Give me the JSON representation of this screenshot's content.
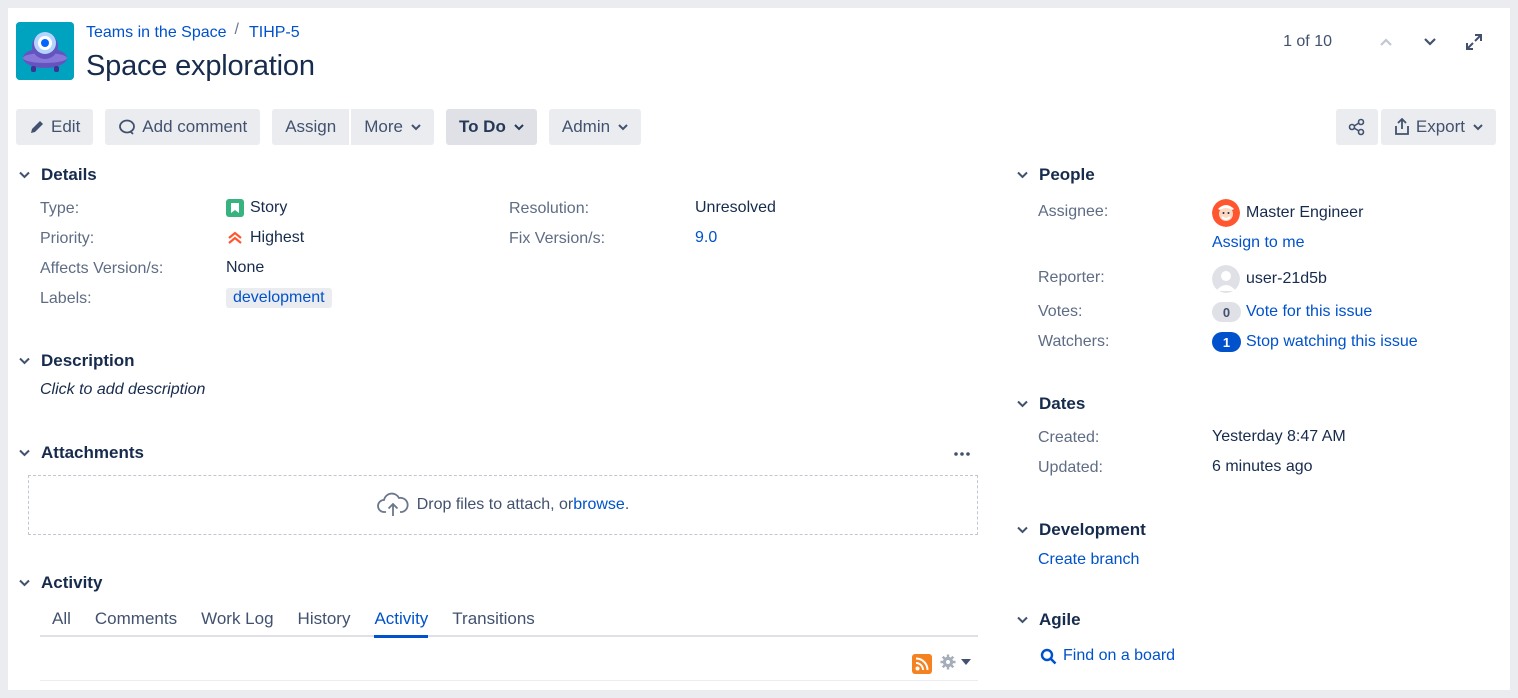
{
  "header": {
    "project_name": "Teams in the Space",
    "breadcrumb_sep": "/",
    "issue_key": "TIHP-5",
    "title": "Space exploration",
    "pager_count": "1 of 10"
  },
  "toolbar": {
    "edit": "Edit",
    "add_comment": "Add comment",
    "assign": "Assign",
    "more": "More",
    "status": "To Do",
    "admin": "Admin",
    "export": "Export"
  },
  "details": {
    "heading": "Details",
    "type_label": "Type:",
    "type_value": "Story",
    "priority_label": "Priority:",
    "priority_value": "Highest",
    "affects_label": "Affects Version/s:",
    "affects_value": "None",
    "labels_label": "Labels:",
    "labels_value": "development",
    "resolution_label": "Resolution:",
    "resolution_value": "Unresolved",
    "fix_label": "Fix Version/s:",
    "fix_value": "9.0"
  },
  "description": {
    "heading": "Description",
    "placeholder": "Click to add description"
  },
  "attachments": {
    "heading": "Attachments",
    "drop_text": "Drop files to attach, or ",
    "browse": "browse",
    "period": "."
  },
  "activity": {
    "heading": "Activity",
    "tabs": [
      "All",
      "Comments",
      "Work Log",
      "History",
      "Activity",
      "Transitions"
    ],
    "active_tab": "Activity"
  },
  "people": {
    "heading": "People",
    "assignee_label": "Assignee:",
    "assignee_value": "Master Engineer",
    "assign_to_me": "Assign to me",
    "reporter_label": "Reporter:",
    "reporter_value": "user-21d5b",
    "votes_label": "Votes:",
    "votes_count": "0",
    "vote_link": "Vote for this issue",
    "watchers_label": "Watchers:",
    "watchers_count": "1",
    "watch_link": "Stop watching this issue"
  },
  "dates": {
    "heading": "Dates",
    "created_label": "Created:",
    "created_value": "Yesterday 8:47 AM",
    "updated_label": "Updated:",
    "updated_value": "6 minutes ago"
  },
  "development": {
    "heading": "Development",
    "create_branch": "Create branch"
  },
  "agile": {
    "heading": "Agile",
    "find_board": "Find on a board"
  },
  "colors": {
    "link": "#0052cc",
    "text": "#172b4d",
    "muted": "#5e6c84",
    "button_bg": "#ebecf0",
    "story_green": "#36b37e",
    "priority_red": "#ff5630"
  }
}
